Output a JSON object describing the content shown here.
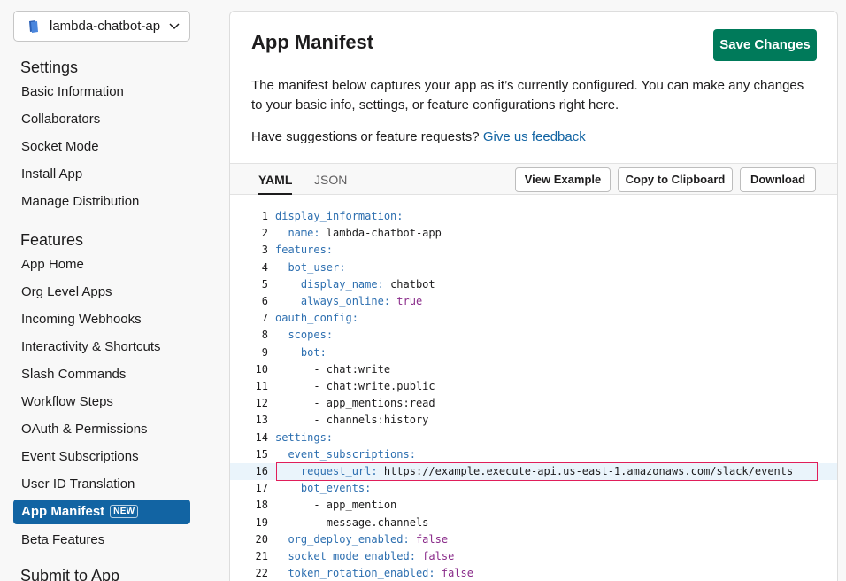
{
  "app_selector": {
    "name": "lambda-chatbot-app"
  },
  "sidebar": {
    "settings_title": "Settings",
    "settings_items": [
      "Basic Information",
      "Collaborators",
      "Socket Mode",
      "Install App",
      "Manage Distribution"
    ],
    "features_title": "Features",
    "features_items": [
      "App Home",
      "Org Level Apps",
      "Incoming Webhooks",
      "Interactivity & Shortcuts",
      "Slash Commands",
      "Workflow Steps",
      "OAuth & Permissions",
      "Event Subscriptions",
      "User ID Translation",
      "App Manifest",
      "Beta Features"
    ],
    "active_badge": "NEW",
    "submit_title": "Submit to App"
  },
  "main": {
    "title": "App Manifest",
    "save_label": "Save Changes",
    "description": "The manifest below captures your app as it’s currently configured. You can make any changes to your basic info, settings, or feature configurations right here.",
    "suggest_text": "Have suggestions or feature requests?",
    "feedback_link": "Give us feedback"
  },
  "toolbar": {
    "tabs": [
      "YAML",
      "JSON"
    ],
    "active_tab": "YAML",
    "view_example": "View Example",
    "copy": "Copy to Clipboard",
    "download": "Download"
  },
  "code_lines": [
    [
      "",
      "display_information",
      ":",
      ""
    ],
    [
      "  ",
      "name",
      ": ",
      "lambda-chatbot-app"
    ],
    [
      "",
      "features",
      ":",
      ""
    ],
    [
      "  ",
      "bot_user",
      ":",
      ""
    ],
    [
      "    ",
      "display_name",
      ": ",
      "chatbot"
    ],
    [
      "    ",
      "always_online",
      ": ",
      "true"
    ],
    [
      "",
      "oauth_config",
      ":",
      ""
    ],
    [
      "  ",
      "scopes",
      ":",
      ""
    ],
    [
      "    ",
      "bot",
      ":",
      ""
    ],
    [
      "      ",
      "",
      "",
      "- chat:write"
    ],
    [
      "      ",
      "",
      "",
      "- chat:write.public"
    ],
    [
      "      ",
      "",
      "",
      "- app_mentions:read"
    ],
    [
      "      ",
      "",
      "",
      "- channels:history"
    ],
    [
      "",
      "settings",
      ":",
      ""
    ],
    [
      "  ",
      "event_subscriptions",
      ":",
      ""
    ],
    [
      "    ",
      "request_url",
      ": ",
      "https://example.execute-api.us-east-1.amazonaws.com/slack/events"
    ],
    [
      "    ",
      "bot_events",
      ":",
      ""
    ],
    [
      "      ",
      "",
      "",
      "- app_mention"
    ],
    [
      "      ",
      "",
      "",
      "- message.channels"
    ],
    [
      "  ",
      "org_deploy_enabled",
      ": ",
      "false"
    ],
    [
      "  ",
      "socket_mode_enabled",
      ": ",
      "false"
    ],
    [
      "  ",
      "token_rotation_enabled",
      ": ",
      "false"
    ],
    [
      "",
      "",
      "",
      ""
    ]
  ],
  "colors": {
    "accent": "#1264a3",
    "save": "#007a5a",
    "key": "#2d6fb0",
    "bool": "#8a2b8a",
    "highlight": "#e01e5a"
  }
}
